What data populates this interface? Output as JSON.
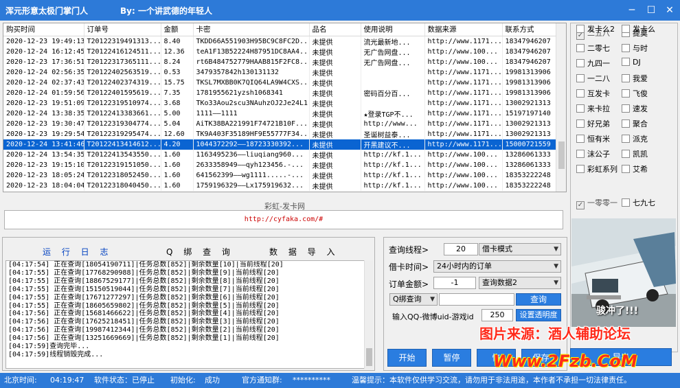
{
  "app": {
    "title": "浑元形意太极门掌门人",
    "author": "By:  一个讲武德的年轻人",
    "win_min": "─",
    "win_max": "☐",
    "win_close": "✕"
  },
  "orders": {
    "columns": [
      "购买时间",
      "订单号",
      "金额",
      "卡密",
      "品名",
      "使用说明",
      "数据来源",
      "联系方式"
    ],
    "rows": [
      [
        "2020-12-23 19:49:13",
        "T20122319491313...",
        "8.40",
        "TKDD66A551903H95BC9C8FC2D...",
        "未提供",
        "流光最新地...",
        "http://www.1171...",
        "18347946207"
      ],
      [
        "2020-12-24 16:12:45",
        "T20122416124511...",
        "12.36",
        "teA1F13B52224H87951DC8AA4...",
        "未提供",
        "无广告网盘...",
        "http://www.100...",
        "18347946207"
      ],
      [
        "2020-12-23 17:36:51",
        "T20122317365111...",
        "8.24",
        "rt6B484752779HAAB815F2FC8...",
        "未提供",
        "无广告网盘...",
        "http://www.100...",
        "18347946207"
      ],
      [
        "2020-12-24 02:56:35",
        "T20122402563519...",
        "0.53",
        "3479357842h130131132",
        "未提供",
        "",
        "http://www.1171...",
        "19981313906"
      ],
      [
        "2020-12-24 02:37:43",
        "T20122402374319...",
        "15.75",
        "TKSL7MXBB0K7QIQ64LA9W4CXS...",
        "未提供",
        "",
        "http://www.1171...",
        "19981313906"
      ],
      [
        "2020-12-24 01:59:56",
        "T20122401595619...",
        "7.35",
        "1781955621yzsh1068341",
        "未提供",
        "密码百分百...",
        "http://www.1171...",
        "19981313906"
      ],
      [
        "2020-12-23 19:51:09",
        "T20122319510974...",
        "3.68",
        "TKo33Aou2scu3NAuhzOJ2Je24L1",
        "未提供",
        "",
        "http://www.1171...",
        "13002921313"
      ],
      [
        "2020-12-24 13:38:35",
        "T20122413383661...",
        "5.00",
        "1111——1111",
        "未提供",
        "★登录TGP不...",
        "http://www.1171...",
        "15197197140"
      ],
      [
        "2020-12-23 19:30:47",
        "T20122319304774...",
        "5.04",
        "AiTK38BA221991F74721B10F...",
        "未提供",
        "http://www...",
        "http://www.1171...",
        "13002921313"
      ],
      [
        "2020-12-23 19:29:54",
        "T20122319295474...",
        "12.60",
        "TK9A403F35189HF9E55777F34...",
        "未提供",
        "圣诞树益泰...",
        "http://www.1171...",
        "13002921313"
      ],
      [
        "2020-12-24 13:41:46",
        "T20122413414612...",
        "4.20",
        "1044372292——18723330392...",
        "未提供",
        "开黑建议不...",
        "http://www.1171...",
        "15000721559"
      ],
      [
        "2020-12-24 13:54:35",
        "T20122413543550...",
        "1.60",
        "1163495236——liuqiang960...",
        "未提供",
        "http://kf.1...",
        "http://www.100...",
        "13286061333"
      ],
      [
        "2020-12-23 19:15:10",
        "T20122319151050...",
        "1.60",
        "2633358949——qyh123456.-...",
        "未提供",
        "http://kf.1...",
        "http://www.100...",
        "13286061333"
      ],
      [
        "2020-12-23 18:05:24",
        "T20122318052450...",
        "1.60",
        "641562399——wg1111.....-...",
        "未提供",
        "http://kf.1...",
        "http://www.100...",
        "18353222248"
      ],
      [
        "2020-12-23 18:04:04",
        "T20122318040450...",
        "1.60",
        "1759196329——Lx175919632...",
        "未提供",
        "http://kf.1...",
        "http://www.100...",
        "18353222248"
      ]
    ],
    "selected_row": 10
  },
  "checkboxes": [
    {
      "label": "二五八",
      "checked": true
    },
    {
      "label": "提莫",
      "checked": false
    },
    {
      "label": "二零七",
      "checked": false
    },
    {
      "label": "与时",
      "checked": false
    },
    {
      "label": "九四一",
      "checked": false
    },
    {
      "label": "DJ",
      "checked": false
    },
    {
      "label": "一二八",
      "checked": false
    },
    {
      "label": "我爱",
      "checked": false
    },
    {
      "label": "互发卡",
      "checked": false
    },
    {
      "label": "飞俊",
      "checked": false
    },
    {
      "label": "来卡拉",
      "checked": false
    },
    {
      "label": "速发",
      "checked": false
    },
    {
      "label": "好兄弟",
      "checked": false
    },
    {
      "label": "聚合",
      "checked": false
    },
    {
      "label": "恒有米",
      "checked": false
    },
    {
      "label": "派克",
      "checked": false
    },
    {
      "label": "沫公子",
      "checked": false
    },
    {
      "label": "凯凯",
      "checked": false
    },
    {
      "label": "彩虹系列",
      "checked": false
    },
    {
      "label": "艾希",
      "checked": false
    },
    {
      "label": "一零零一",
      "checked": true
    },
    {
      "label": "七九七",
      "checked": false
    },
    {
      "label": "发卡么2",
      "checked": false
    },
    {
      "label": "发卡么",
      "checked": false
    }
  ],
  "photo": {
    "caption": "骏冲了!!!"
  },
  "banner": {
    "label": "彩虹-发卡网",
    "url": "http://cyfaka.com/#"
  },
  "log": {
    "headers": [
      "运 行 日 志",
      "Q 绑 查 询",
      "数 据 导 入"
    ],
    "lines": [
      "[04:17:54] 正在查询[18054190711]|任务总数[852]|剩余数量[10]|当前线程[20]",
      "[04:17:55] 正在查询[17768290988]|任务总数[852]|剩余数量[9]|当前线程[20]",
      "[04:17:55] 正在查询[18867529177]|任务总数[852]|剩余数量[8]|当前线程[20]",
      "[04:17:55] 正在查询[15150519044]|任务总数[852]|剩余数量[7]|当前线程[20]",
      "[04:17:55] 正在查询[17671277297]|任务总数[852]|剩余数量[6]|当前线程[20]",
      "[04:17:55] 正在查询[18605659802]|任务总数[852]|剩余数量[5]|当前线程[20]",
      "[04:17:56] 正在查询[15681466622]|任务总数[852]|剩余数量[4]|当前线程[20]",
      "[04:17:56] 正在查询[17625218451]|任务总数[852]|剩余数量[3]|当前线程[20]",
      "[04:17:56] 正在查询[19987412344]|任务总数[852]|剩余数量[2]|当前线程[20]",
      "[04:17:56] 正在查询[13251669669]|任务总数[852]|剩余数量[1]|当前线程[20]",
      "[04:17:59]查询完毕...",
      "[04:17:59]线程销毁完成..."
    ]
  },
  "controls": {
    "thread_label": "查询线程>",
    "thread_value": "20",
    "mode_value": "借卡模式",
    "time_label": "借卡时间>",
    "time_value": "24小时内的订单",
    "amount_label": "订单金额>",
    "amount_value": "-1",
    "query_mode_value": "查询数据2",
    "qbind_value": "Q绑查询",
    "query_input_value": "",
    "query_button": "查询",
    "uid_label": "输入QQ-微博uid-游戏id",
    "opacity_value": "250",
    "opacity_button": "设置透明度",
    "start_button": "开始",
    "pause_button": "暂停",
    "restore_button": "恢",
    "button4": "保存",
    "button5": "导出"
  },
  "watermark": {
    "line1": "图片来源：酒人辅助论坛",
    "line2": "Www.2Fzb.CoM"
  },
  "status": {
    "time_label": "北京时间:",
    "time_value": "04:19:47",
    "state_label": "软件状态：已停止",
    "init_label": "初始化:",
    "init_value": "成功",
    "notice_label": "官方通知群:",
    "notice_value": "**********",
    "hint": "温馨提示：本软件仅供学习交流，请勿用于非法用途，本作者不承担一切法律责任。"
  }
}
